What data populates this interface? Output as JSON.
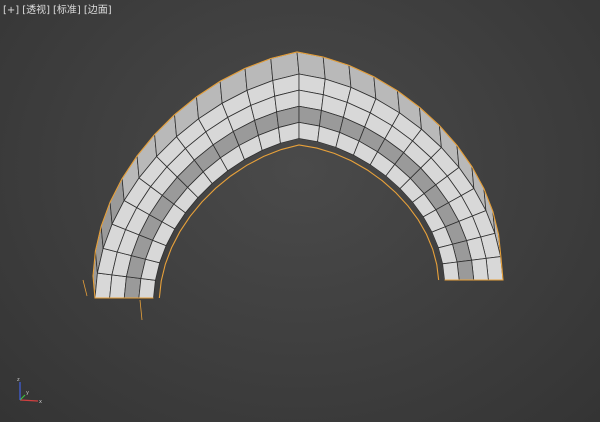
{
  "viewport": {
    "labels": {
      "menu": "[+]",
      "view": "[透视]",
      "shading": "[标准]",
      "style": "[边面]"
    }
  },
  "colors": {
    "background": "#3e3e3e",
    "face_light": "#d8d8d8",
    "face_mid": "#9a9a9a",
    "face_dark": "#5e5e5e",
    "wire": "#2f2f2f",
    "selection": "#e8a13a",
    "axis_x": "#d04040",
    "axis_y": "#40c040",
    "axis_z": "#4060e0"
  },
  "gizmo": {
    "x_label": "x",
    "y_label": "y",
    "z_label": "z"
  },
  "object": {
    "type": "arch",
    "selected": true
  }
}
